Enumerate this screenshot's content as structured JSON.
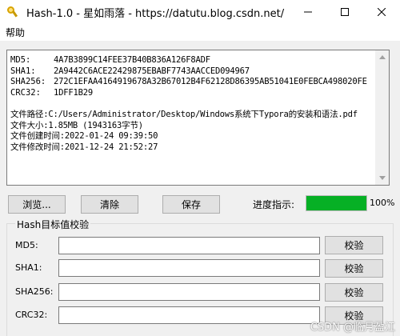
{
  "window": {
    "title": "Hash-1.0 - 星如雨落 - https://datutu.blog.csdn.net/"
  },
  "menu": {
    "items": [
      "帮助"
    ]
  },
  "output": {
    "hashes": [
      {
        "label": "MD5:",
        "value": "4A7B3899C14FEE37B40B836A126F8ADF"
      },
      {
        "label": "SHA1:",
        "value": "2A9442C6ACE22429875EBABF7743AACCED094967"
      },
      {
        "label": "SHA256:",
        "value": "272C1EFAA4164919678A32B67012B4F62128D86395AB51041E0FEBCA498020FE"
      },
      {
        "label": "CRC32:",
        "value": "1DFF1B29"
      }
    ],
    "file_path": "文件路径:C:/Users/Administrator/Desktop/Windows系统下Typora的安装和语法.pdf",
    "file_size": "文件大小:1.85MB   (1943163字节)",
    "created": "文件创建时间:2022-01-24 09:39:50",
    "modified": "文件修改时间:2021-12-24 21:52:27"
  },
  "toolbar": {
    "browse_label": "浏览...",
    "clear_label": "清除",
    "save_label": "保存",
    "progress_label": "进度指示:",
    "progress_value": 1.0,
    "progress_text": "100%",
    "progress_color": "#06b025"
  },
  "verify_group": {
    "title": "Hash目标值校验",
    "fields": [
      {
        "label": "MD5:",
        "value": "",
        "button": "校验"
      },
      {
        "label": "SHA1:",
        "value": "",
        "button": "校验"
      },
      {
        "label": "SHA256:",
        "value": "",
        "button": "校验"
      },
      {
        "label": "CRC32:",
        "value": "",
        "button": "校验"
      }
    ]
  },
  "watermark": "CSDN @临月盈江"
}
